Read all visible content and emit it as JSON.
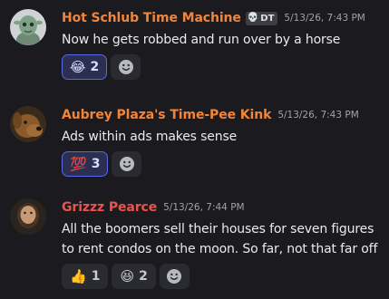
{
  "messages": [
    {
      "author": "Hot Schlub Time Machine",
      "author_color": "#f2853a",
      "tag": {
        "icon": "skull-icon",
        "glyph": "💀",
        "label": "DT"
      },
      "timestamp": "5/13/26, 7:43 PM",
      "lines": [
        "Now he gets robbed and run over by a horse"
      ],
      "avatar": "alien-avatar",
      "reactions": [
        {
          "emoji": "😂",
          "count": "2",
          "active": true
        }
      ]
    },
    {
      "author": "Aubrey Plaza's Time-Pee Kink",
      "author_color": "#f2853a",
      "timestamp": "5/13/26, 7:43 PM",
      "lines": [
        "Ads within ads makes sense"
      ],
      "avatar": "dog-avatar",
      "reactions": [
        {
          "emoji": "💯",
          "count": "3",
          "active": true
        }
      ]
    },
    {
      "author": "Grizzz Pearce",
      "author_color": "#e8544f",
      "timestamp": "5/13/26, 7:44 PM",
      "lines": [
        "All the boomers sell their houses for seven figures",
        "to rent condos on the moon. So far, not that far off"
      ],
      "avatar": "bearded-man-avatar",
      "reactions": [
        {
          "emoji": "👍",
          "count": "1",
          "active": false
        },
        {
          "emoji": "😆",
          "count": "2",
          "active": false
        }
      ]
    }
  ],
  "add_reaction_icon": "add-reaction-smiley-icon"
}
